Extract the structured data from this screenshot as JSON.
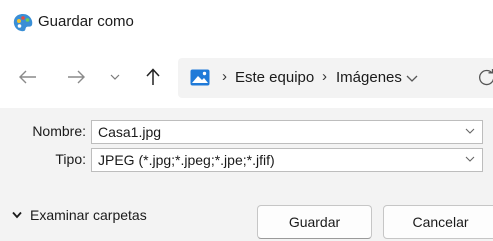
{
  "window": {
    "title": "Guardar como",
    "icon": "paint-palette-icon"
  },
  "nav": {
    "back_icon": "arrow-left-icon",
    "forward_icon": "arrow-right-icon",
    "recent_icon": "chevron-down-icon",
    "up_icon": "arrow-up-icon",
    "refresh_icon": "refresh-icon"
  },
  "address": {
    "icon": "pictures-folder-icon",
    "separator": "›",
    "crumbs": [
      "Este equipo",
      "Imágenes"
    ]
  },
  "form": {
    "name_label": "Nombre:",
    "name_value": "Casa1.jpg",
    "type_label": "Tipo:",
    "type_value": "JPEG (*.jpg;*.jpeg;*.jpe;*.jfif)"
  },
  "footer": {
    "browse_label": "Examinar carpetas",
    "save_label": "Guardar",
    "cancel_label": "Cancelar"
  },
  "colors": {
    "accent": "#0067c0",
    "panel_bg": "#f3f3f3",
    "window_bg": "#ffffff"
  }
}
